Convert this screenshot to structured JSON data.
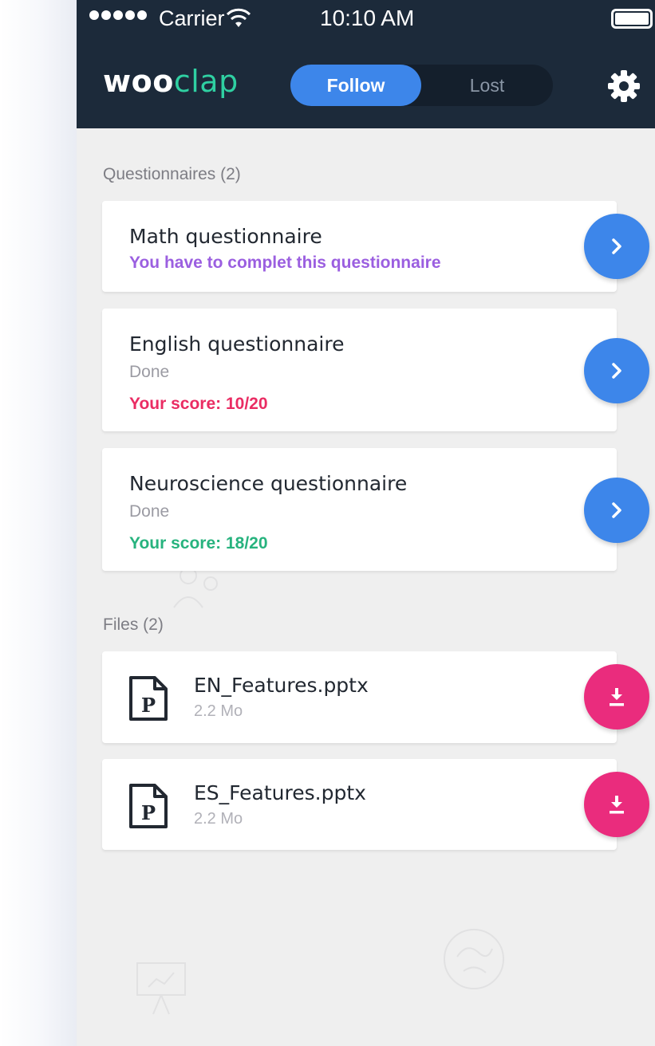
{
  "status_bar": {
    "carrier": "Carrier",
    "time": "10:10 AM",
    "signal_icon": "signal-dots-icon",
    "wifi_icon": "wifi-icon",
    "battery_icon": "battery-icon"
  },
  "header": {
    "logo_bold": "woo",
    "logo_light": "clap",
    "segments": [
      {
        "label": "Follow",
        "selected": true
      },
      {
        "label": "Lost",
        "selected": false
      }
    ],
    "settings_icon": "gear-icon"
  },
  "questionnaires": {
    "title": "Questionnaires (2)",
    "items": [
      {
        "name": "Math questionnaire",
        "status": "",
        "sub": "You have to complet this questionnaire",
        "sub_color": "#9b5fe0"
      },
      {
        "name": "English questionnaire",
        "status": "Done",
        "sub": "Your score: 10/20",
        "sub_color": "#ea2c63"
      },
      {
        "name": "Neuroscience questionnaire",
        "status": "Done",
        "sub": "Your score: 18/20",
        "sub_color": "#27b37e"
      }
    ],
    "action_icon": "chevron-right-icon"
  },
  "files": {
    "title": "Files (2)",
    "items": [
      {
        "name": "EN_Features.pptx",
        "size": "2.2 Mo"
      },
      {
        "name": "ES_Features.pptx",
        "size": "2.2 Mo"
      }
    ],
    "file_icon": "powerpoint-file-icon",
    "action_icon": "download-icon"
  },
  "colors": {
    "header_bg": "#1c2a3a",
    "accent_blue": "#3d86ea",
    "accent_pink": "#ea2c7d",
    "logo_green": "#2fd0a2",
    "content_bg": "#efefef"
  }
}
